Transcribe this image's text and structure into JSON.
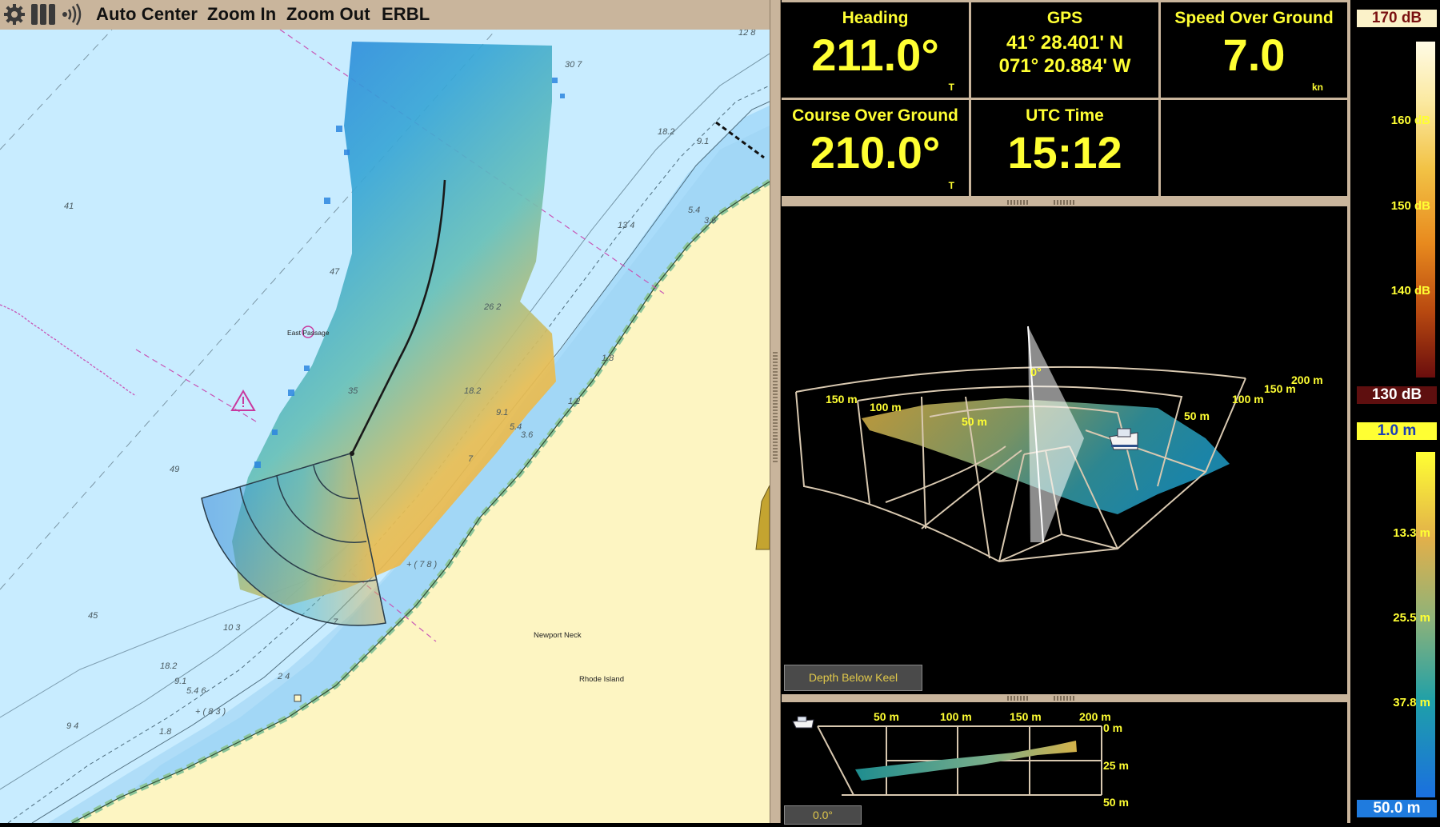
{
  "toolbar": {
    "icons": [
      "gear-icon",
      "columns-icon",
      "sonar-ping-icon"
    ],
    "buttons": [
      "Auto Center",
      "Zoom In",
      "Zoom Out",
      "ERBL"
    ]
  },
  "readouts": {
    "heading": {
      "label": "Heading",
      "value": "211.0°",
      "unit": "T"
    },
    "gps": {
      "label": "GPS",
      "lat": "41° 28.401' N",
      "lon": "071° 20.884' W"
    },
    "sog": {
      "label": "Speed Over Ground",
      "value": "7.0",
      "unit": "kn"
    },
    "cog": {
      "label": "Course Over Ground",
      "value": "210.0°",
      "unit": "T"
    },
    "utc": {
      "label": "UTC Time",
      "value": "15:12"
    }
  },
  "chart": {
    "place_labels": [
      "East Passage",
      "Newport Neck",
      "Rhode Island"
    ],
    "soundings": [
      "12 8",
      "30 7",
      "18.2",
      "9.1",
      "13 4",
      "5.4",
      "3.6",
      "41",
      "47",
      "26 2",
      "35",
      "18.2",
      "9.1",
      "5.4",
      "3.6",
      "1.8",
      "1 2",
      "7",
      "49",
      "45",
      "10 3",
      "7",
      "18.2",
      "9.1",
      "5.4 6",
      "2 4",
      "9 4",
      "1.8",
      "+ ( 7 8 )",
      "+ ( 8 3 )"
    ]
  },
  "view3d": {
    "labels": [
      "0°",
      "150 m",
      "100 m",
      "50 m",
      "50 m",
      "100 m",
      "150 m",
      "200 m"
    ],
    "depth_below_keel_button": "Depth Below Keel"
  },
  "profile": {
    "x_labels": [
      "50 m",
      "100 m",
      "150 m",
      "200 m"
    ],
    "y_labels": [
      "0 m",
      "25 m",
      "50 m"
    ],
    "angle": "0.0°"
  },
  "scale": {
    "db_top": "170 dB",
    "db_ticks": [
      "160 dB",
      "150 dB",
      "140 dB"
    ],
    "db_bottom": "130 dB",
    "depth_top": "1.0 m",
    "depth_ticks": [
      "13.3 m",
      "25.5 m",
      "37.8 m"
    ],
    "depth_bottom": "50.0 m"
  },
  "colors": {
    "frame": "#c9b59c",
    "readout_text": "#ffff33",
    "water": "#c8ecff",
    "land": "#fdf5c2"
  }
}
